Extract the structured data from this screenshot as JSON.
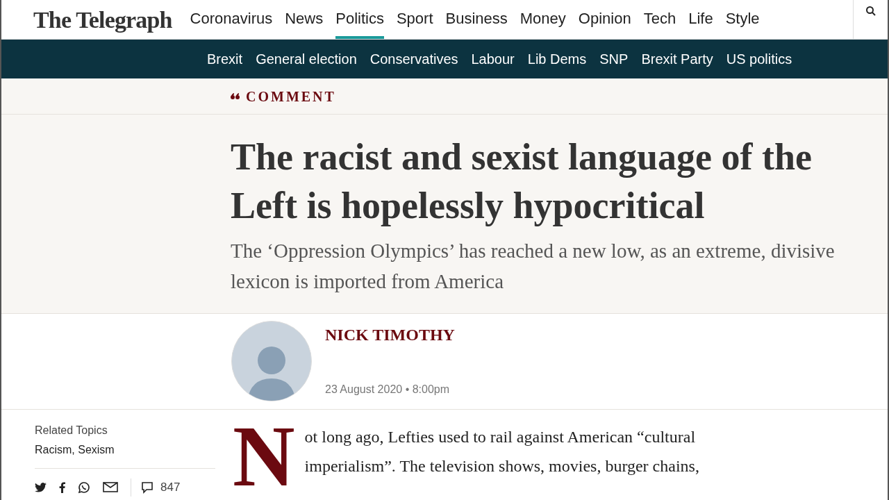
{
  "logo": "The Telegraph",
  "nav": [
    {
      "label": "Coronavirus",
      "selected": false
    },
    {
      "label": "News",
      "selected": false
    },
    {
      "label": "Politics",
      "selected": true
    },
    {
      "label": "Sport",
      "selected": false
    },
    {
      "label": "Business",
      "selected": false
    },
    {
      "label": "Money",
      "selected": false
    },
    {
      "label": "Opinion",
      "selected": false
    },
    {
      "label": "Tech",
      "selected": false
    },
    {
      "label": "Life",
      "selected": false
    },
    {
      "label": "Style",
      "selected": false
    }
  ],
  "subnav": [
    "Brexit",
    "General election",
    "Conservatives",
    "Labour",
    "Lib Dems",
    "SNP",
    "Brexit Party",
    "US politics"
  ],
  "section_label": "COMMENT",
  "headline": "The racist and sexist language of the Left is hopelessly hypocritical",
  "standfirst": "The ‘Oppression Olympics’ has reached a new low, as an extreme, divisive lexicon is imported from America",
  "author": {
    "name": "NICK TIMOTHY",
    "date": "23 August 2020 • 8:00pm"
  },
  "related": {
    "heading": "Related Topics",
    "topics": "Racism, Sexism"
  },
  "comments": "847",
  "body": {
    "dropcap": "N",
    "text": "ot long ago, Lefties used to rail against American “cultural imperialism”. The television shows, movies, burger chains,"
  }
}
